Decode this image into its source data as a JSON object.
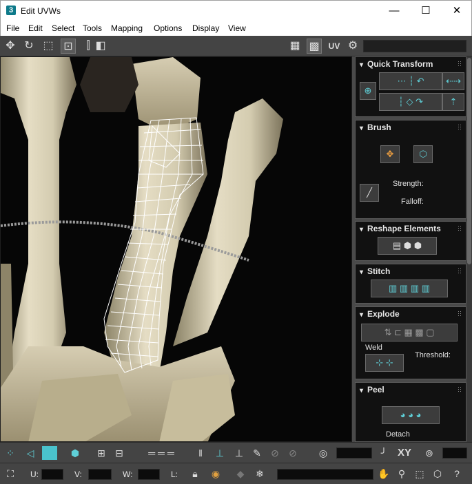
{
  "window": {
    "app_icon": "3",
    "title": "Edit UVWs",
    "minimize": "—",
    "maximize": "☐",
    "close": "✕"
  },
  "menu": [
    "File",
    "Edit",
    "Select",
    "Tools",
    "Mapping",
    "Options",
    "Display",
    "View"
  ],
  "toolbar": {
    "uv_label": "UV"
  },
  "panel": {
    "quick_transform": {
      "title": "Quick Transform"
    },
    "brush": {
      "title": "Brush",
      "strength": "Strength:",
      "falloff": "Falloff:"
    },
    "reshape": {
      "title": "Reshape Elements"
    },
    "stitch": {
      "title": "Stitch"
    },
    "explode": {
      "title": "Explode",
      "weld": "Weld",
      "threshold": "Threshold:"
    },
    "peel": {
      "title": "Peel",
      "detach": "Detach"
    }
  },
  "bottom": {
    "xy": "XY",
    "u_label": "U:",
    "v_label": "V:",
    "w_label": "W:",
    "l_label": "L:"
  },
  "colors": {
    "accent": "#5fd0d8",
    "panel_bg": "#111111",
    "toolbar_bg": "#444444"
  }
}
